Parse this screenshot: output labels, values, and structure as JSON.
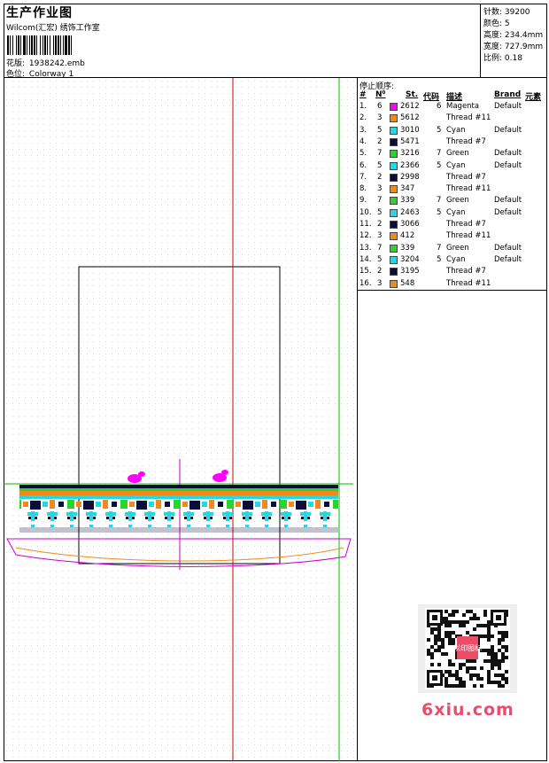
{
  "header": {
    "title": "生产作业图",
    "subtitle": "Wilcom(汇宏) 绣饰工作室",
    "design_label": "花版:",
    "design_value": "1938242.emb",
    "colorway_label": "色位:",
    "colorway_value": "Colorway 1"
  },
  "stats": {
    "stitches": "针数: 39200",
    "colors": "颜色: 5",
    "height": "高度: 234.4mm",
    "width": "宽度: 727.9mm",
    "scale": "比例: 0.18"
  },
  "stop_sequence": {
    "title": "停止顺序:",
    "columns": {
      "num": "#",
      "n": "N⁰",
      "st": "St.",
      "code": "代码",
      "desc": "描述",
      "brand": "Brand",
      "elem": "元素"
    },
    "rows": [
      {
        "num": "1.",
        "n": "6",
        "color": "#ff00ff",
        "st": "2612",
        "code": "6",
        "desc": "Magenta",
        "brand": "Default"
      },
      {
        "num": "2.",
        "n": "3",
        "color": "#f08a1c",
        "st": "5612",
        "code": "",
        "desc": "Thread #11",
        "brand": ""
      },
      {
        "num": "3.",
        "n": "5",
        "color": "#22d8e6",
        "st": "3010",
        "code": "5",
        "desc": "Cyan",
        "brand": "Default"
      },
      {
        "num": "4.",
        "n": "2",
        "color": "#0c0c3a",
        "st": "5471",
        "code": "",
        "desc": "Thread #7",
        "brand": ""
      },
      {
        "num": "5.",
        "n": "7",
        "color": "#2ad42a",
        "st": "3216",
        "code": "7",
        "desc": "Green",
        "brand": "Default"
      },
      {
        "num": "6.",
        "n": "5",
        "color": "#22d8e6",
        "st": "2366",
        "code": "5",
        "desc": "Cyan",
        "brand": "Default"
      },
      {
        "num": "7.",
        "n": "2",
        "color": "#0c0c3a",
        "st": "2998",
        "code": "",
        "desc": "Thread #7",
        "brand": ""
      },
      {
        "num": "8.",
        "n": "3",
        "color": "#f08a1c",
        "st": "347",
        "code": "",
        "desc": "Thread #11",
        "brand": ""
      },
      {
        "num": "9.",
        "n": "7",
        "color": "#2ad42a",
        "st": "339",
        "code": "7",
        "desc": "Green",
        "brand": "Default"
      },
      {
        "num": "10.",
        "n": "5",
        "color": "#22d8e6",
        "st": "2463",
        "code": "5",
        "desc": "Cyan",
        "brand": "Default"
      },
      {
        "num": "11.",
        "n": "2",
        "color": "#0c0c3a",
        "st": "3066",
        "code": "",
        "desc": "Thread #7",
        "brand": ""
      },
      {
        "num": "12.",
        "n": "3",
        "color": "#f08a1c",
        "st": "412",
        "code": "",
        "desc": "Thread #11",
        "brand": ""
      },
      {
        "num": "13.",
        "n": "7",
        "color": "#2ad42a",
        "st": "339",
        "code": "7",
        "desc": "Green",
        "brand": "Default"
      },
      {
        "num": "14.",
        "n": "5",
        "color": "#22d8e6",
        "st": "3204",
        "code": "5",
        "desc": "Cyan",
        "brand": "Default"
      },
      {
        "num": "15.",
        "n": "2",
        "color": "#0c0c3a",
        "st": "3195",
        "code": "",
        "desc": "Thread #7",
        "brand": ""
      },
      {
        "num": "16.",
        "n": "3",
        "color": "#f08a1c",
        "st": "548",
        "code": "",
        "desc": "Thread #11",
        "brand": ""
      }
    ]
  },
  "watermark": {
    "site": "6xiu.com",
    "stamp": "以印图标"
  },
  "colors": {
    "center_line": "#d00000",
    "guide_line": "#00c000",
    "outline": "#cc00cc",
    "frame": "#000000"
  }
}
